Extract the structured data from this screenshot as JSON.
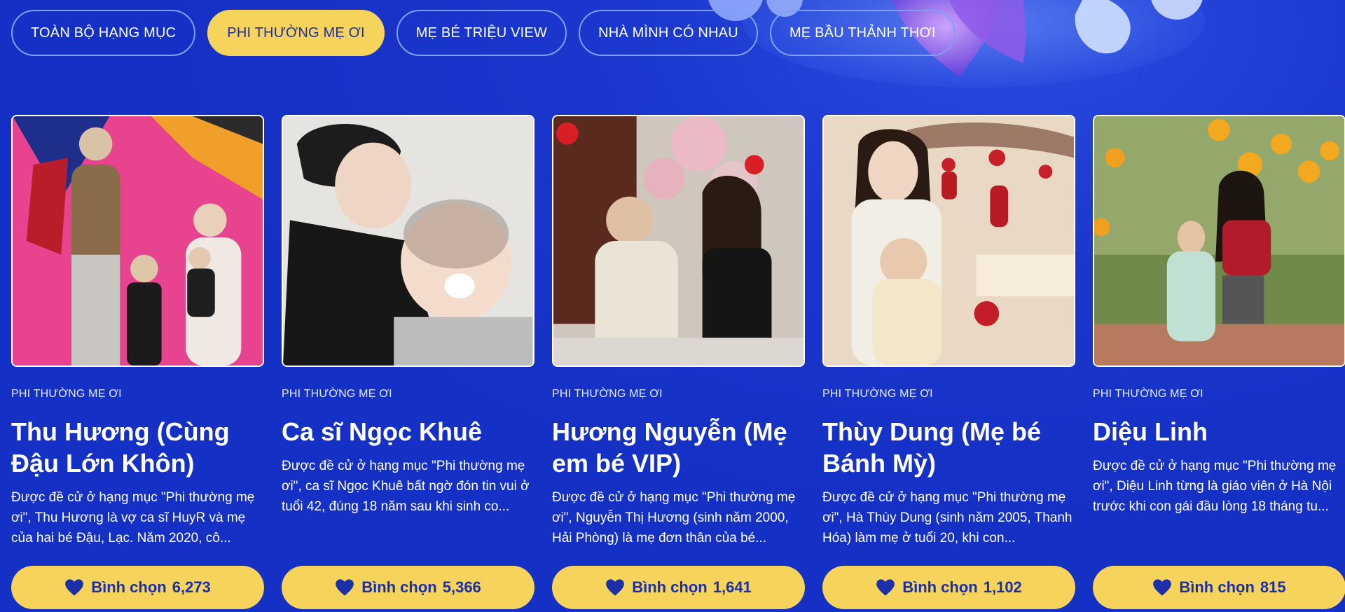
{
  "tabs": [
    {
      "label": "TOÀN BỘ HẠNG MỤC",
      "active": false
    },
    {
      "label": "PHI THƯỜNG MẸ ƠI",
      "active": true
    },
    {
      "label": "MẸ BÉ TRIỆU VIEW",
      "active": false
    },
    {
      "label": "NHÀ MÌNH CÓ NHAU",
      "active": false
    },
    {
      "label": "MẸ BẦU THẢNH THƠI",
      "active": false
    }
  ],
  "cards": [
    {
      "category": "PHI THƯỜNG MẸ ƠI",
      "name": "Thu Hương (Cùng Đậu Lớn Khôn)",
      "description": "Được đề cử ở hạng mục \"Phi thường mẹ ơi\", Thu Hương là vợ ca sĩ HuyR và mẹ của hai bé Đậu, Lạc. Năm 2020, cô...",
      "vote_label": "Bình chọn",
      "vote_count": "6,273"
    },
    {
      "category": "PHI THƯỜNG MẸ ƠI",
      "name": "Ca sĩ Ngọc Khuê",
      "description": "Được đề cử ở hạng mục \"Phi thường mẹ ơi\", ca sĩ Ngọc Khuê bất ngờ đón tin vui ở tuổi 42, đúng 18 năm sau khi sinh co...",
      "vote_label": "Bình chọn",
      "vote_count": "5,366"
    },
    {
      "category": "PHI THƯỜNG MẸ ƠI",
      "name": "Hương Nguyễn (Mẹ em bé VIP)",
      "description": "Được đề cử ở hạng mục \"Phi thường mẹ ơi\", Nguyễn Thị Hương (sinh năm 2000, Hải Phòng) là mẹ đơn thân của bé...",
      "vote_label": "Bình chọn",
      "vote_count": "1,641"
    },
    {
      "category": "PHI THƯỜNG MẸ ƠI",
      "name": "Thùy Dung (Mẹ bé Bánh Mỳ)",
      "description": "Được đề cử ở hạng mục \"Phi thường mẹ ơi\", Hà Thùy Dung (sinh năm 2005, Thanh Hóa) làm mẹ ở tuổi 20, khi con...",
      "vote_label": "Bình chọn",
      "vote_count": "1,102"
    },
    {
      "category": "PHI THƯỜNG MẸ ƠI",
      "name": "Diệu Linh",
      "description": "Được đề cử ở hạng mục \"Phi thường mẹ ơi\", Diệu Linh từng là giáo viên ở Hà Nội trước khi con gái đầu lòng 18 tháng tu...",
      "vote_label": "Bình chọn",
      "vote_count": "815"
    }
  ],
  "colors": {
    "background": "#1530c4",
    "accent_yellow": "#f6d35a",
    "button_text": "#1a2fa8"
  },
  "icons": {
    "vote": "heart-icon"
  }
}
